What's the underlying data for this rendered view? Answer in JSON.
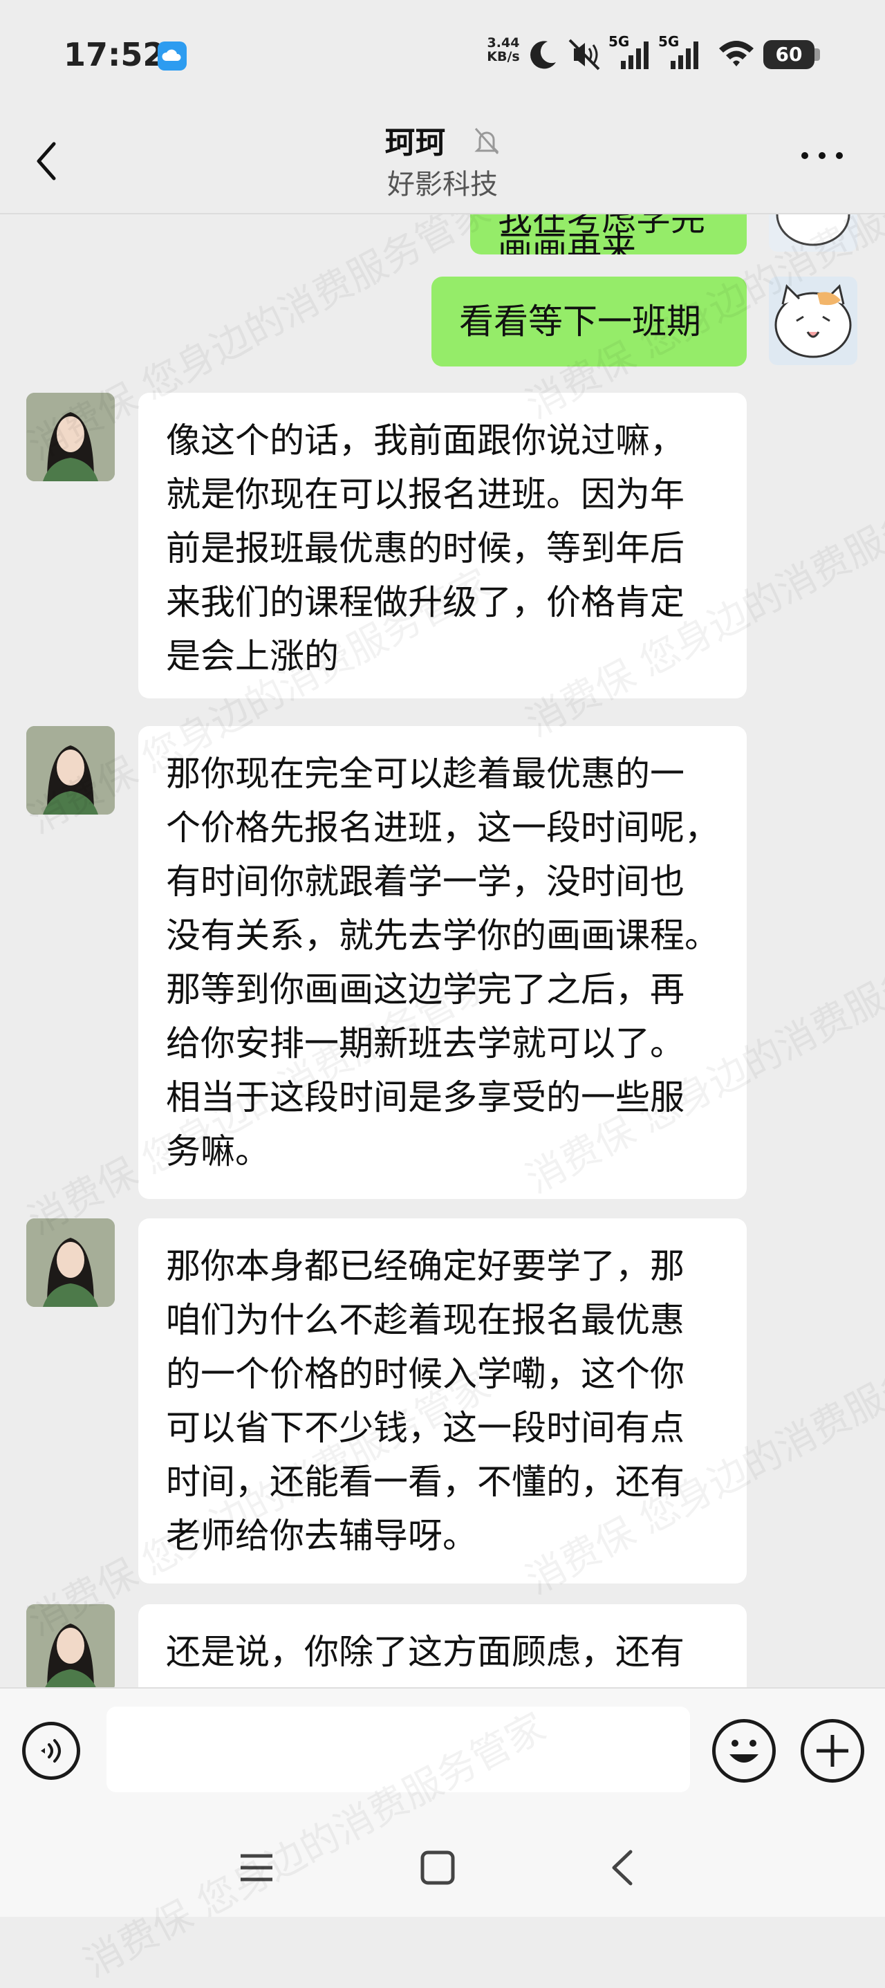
{
  "status_bar": {
    "time": "17:52",
    "net_speed_value": "3.44",
    "net_speed_unit": "KB/s",
    "signal1_label": "5G",
    "signal2_label": "5G",
    "battery": "60",
    "icons": [
      "cloud-app-icon",
      "moon-icon",
      "mute-icon",
      "signal-icon",
      "wifi-icon",
      "battery-icon"
    ]
  },
  "header": {
    "contact_name": "珂珂",
    "company": "好影科技",
    "icons": [
      "back-icon",
      "mute-bell-icon",
      "more-icon"
    ]
  },
  "messages": [
    {
      "from": "me",
      "text": "我在考虑学完画画再来"
    },
    {
      "from": "me",
      "text": "看看等下一班期"
    },
    {
      "from": "contact",
      "text": "像这个的话，我前面跟你说过嘛，\n就是你现在可以报名进班。因为年\n前是报班最优惠的时候，等到年后\n来我们的课程做升级了，价格肯定\n是会上涨的"
    },
    {
      "from": "contact",
      "text": "那你现在完全可以趁着最优惠的一\n个价格先报名进班，这一段时间呢，\n有时间你就跟着学一学，没时间也\n没有关系，就先去学你的画画课程。\n那等到你画画这边学完了之后，再\n给你安排一期新班去学就可以了。\n相当于这段时间是多享受的一些服\n务嘛。"
    },
    {
      "from": "contact",
      "text": "那你本身都已经确定好要学了，那\n咱们为什么不趁着现在报名最优惠\n的一个价格的时候入学嘞，这个你\n可以省下不少钱，这一段时间有点\n时间，还能看一看，不懂的，还有\n老师给你去辅导呀。"
    },
    {
      "from": "contact",
      "text": "还是说，你除了这方面顾虑，还有"
    }
  ],
  "input_bar": {
    "text_value": "",
    "icons": [
      "voice-icon",
      "mic-icon",
      "emoji-icon",
      "plus-icon"
    ]
  },
  "nav_bar": {
    "icons": [
      "menu-icon",
      "home-icon",
      "back-nav-icon"
    ]
  },
  "watermark": "消费保 您身边的消费服务管家",
  "colors": {
    "background": "#ededed",
    "my_bubble": "#95ec69",
    "contact_bubble": "#ffffff",
    "input_bar": "#f7f7f7"
  }
}
